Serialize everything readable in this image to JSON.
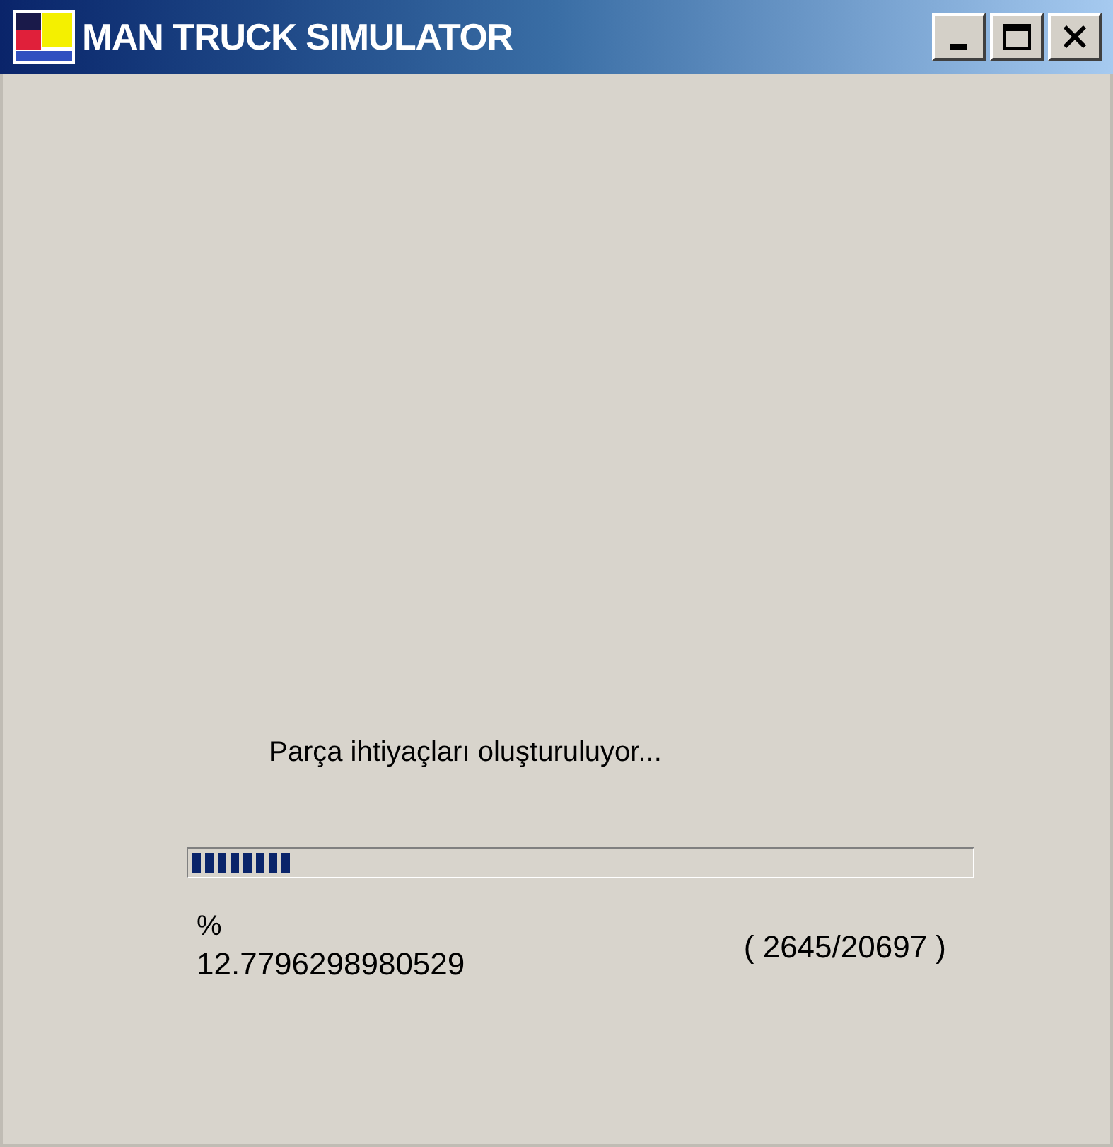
{
  "window": {
    "title": "MAN TRUCK SIMULATOR"
  },
  "status": "Parça ihtiyaçları oluşturuluyor...",
  "progress": {
    "level": 0.128
  },
  "percent_sign": "%",
  "percent_value": "12.7796298980529",
  "count": "( 2645/20697 )"
}
